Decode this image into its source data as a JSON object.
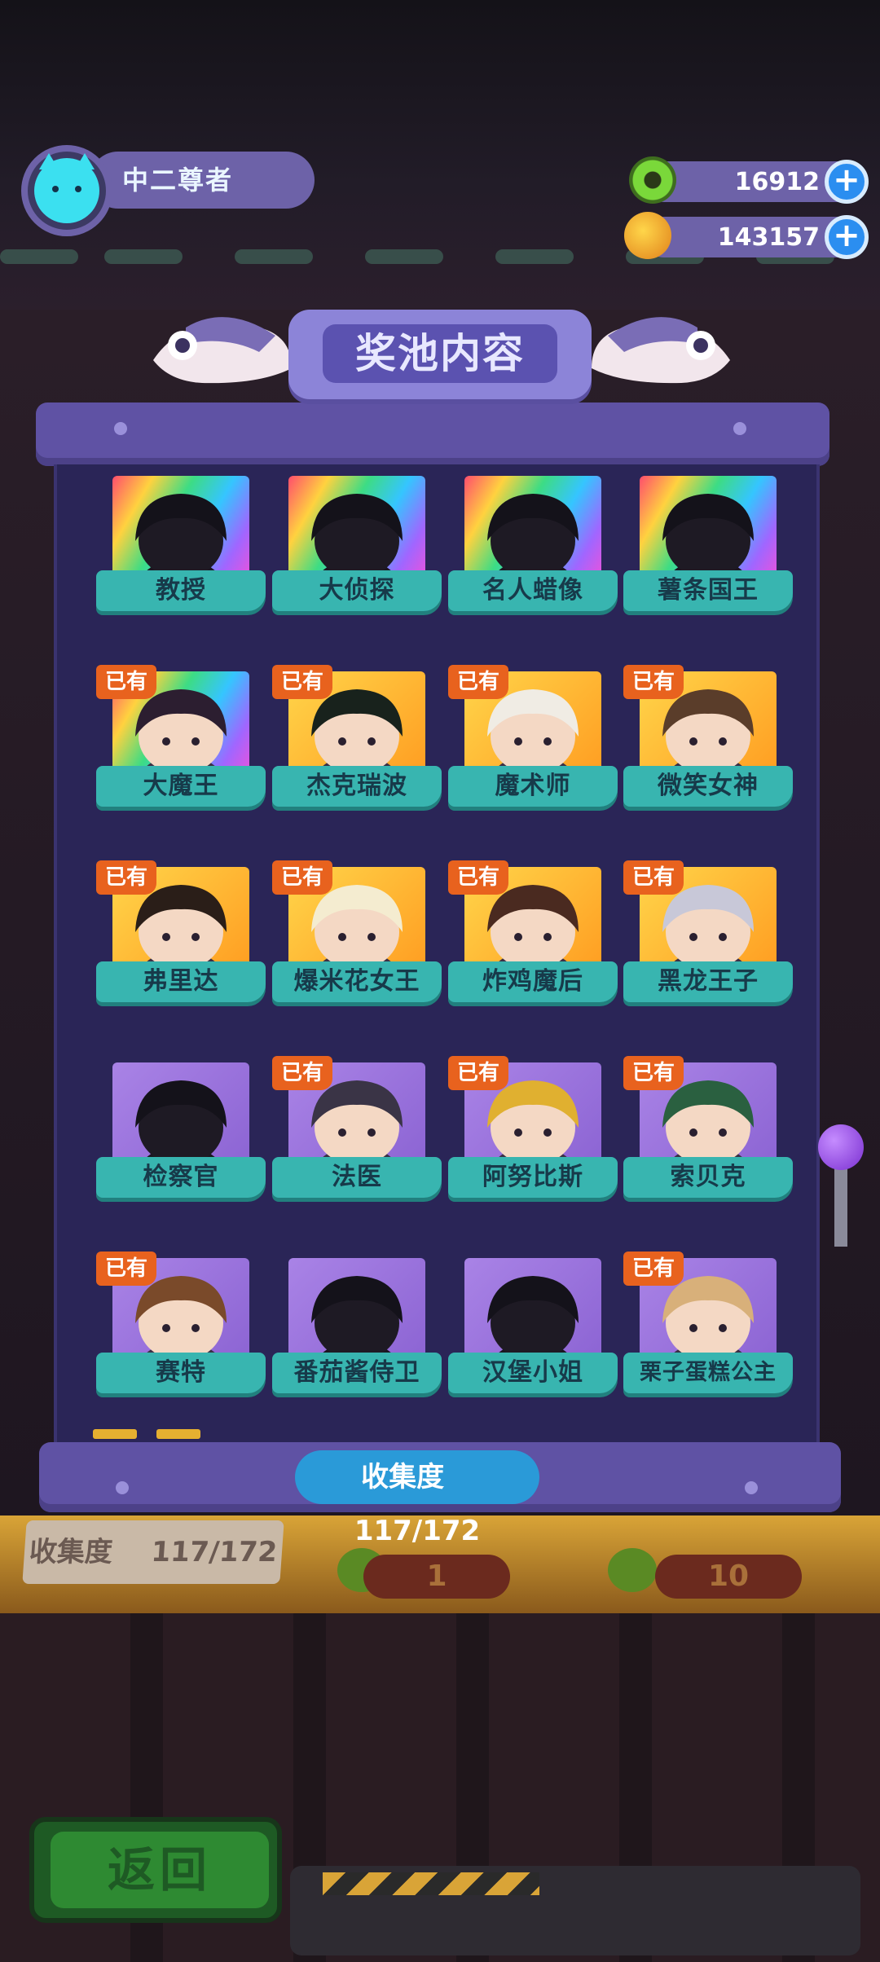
{
  "player": {
    "name": "中二尊者",
    "avatar_icon": "cat-avatar-icon"
  },
  "currency": [
    {
      "icon": "green-donut-icon",
      "value": "16912",
      "plus": "+"
    },
    {
      "icon": "planet-coin-icon",
      "value": "143157",
      "plus": "+"
    }
  ],
  "panel": {
    "title": "奖池内容",
    "owned_badge": "已有",
    "progress_label": "收集度",
    "progress_value": "117/172",
    "collection": {
      "owned": 117,
      "total": 172
    }
  },
  "characters": [
    {
      "name": "教授",
      "owned": false,
      "rarity": "rainbow"
    },
    {
      "name": "大侦探",
      "owned": false,
      "rarity": "rainbow"
    },
    {
      "name": "名人蜡像",
      "owned": false,
      "rarity": "rainbow"
    },
    {
      "name": "薯条国王",
      "owned": false,
      "rarity": "rainbow"
    },
    {
      "name": "大魔王",
      "owned": true,
      "rarity": "rainbow"
    },
    {
      "name": "杰克瑞波",
      "owned": true,
      "rarity": "gold"
    },
    {
      "name": "魔术师",
      "owned": true,
      "rarity": "gold"
    },
    {
      "name": "微笑女神",
      "owned": true,
      "rarity": "gold"
    },
    {
      "name": "弗里达",
      "owned": true,
      "rarity": "gold"
    },
    {
      "name": "爆米花女王",
      "owned": true,
      "rarity": "gold"
    },
    {
      "name": "炸鸡魔后",
      "owned": true,
      "rarity": "gold"
    },
    {
      "name": "黑龙王子",
      "owned": true,
      "rarity": "gold"
    },
    {
      "name": "检察官",
      "owned": false,
      "rarity": "purple"
    },
    {
      "name": "法医",
      "owned": true,
      "rarity": "purple"
    },
    {
      "name": "阿努比斯",
      "owned": true,
      "rarity": "purple"
    },
    {
      "name": "索贝克",
      "owned": true,
      "rarity": "purple"
    },
    {
      "name": "赛特",
      "owned": true,
      "rarity": "purple"
    },
    {
      "name": "番茄酱侍卫",
      "owned": false,
      "rarity": "purple"
    },
    {
      "name": "汉堡小姐",
      "owned": false,
      "rarity": "purple"
    },
    {
      "name": "栗子蛋糕公主",
      "owned": true,
      "rarity": "purple"
    }
  ],
  "background": {
    "collect_label": "收集度",
    "collect_value": "117/172",
    "price_a": "1",
    "price_b": "10"
  },
  "back_button": "返回",
  "colors": {
    "panel": "#5f52a4",
    "ribbon": "#38b5b0",
    "owned_badge": "#e8621e",
    "progress_pill": "#2a9ad8"
  }
}
